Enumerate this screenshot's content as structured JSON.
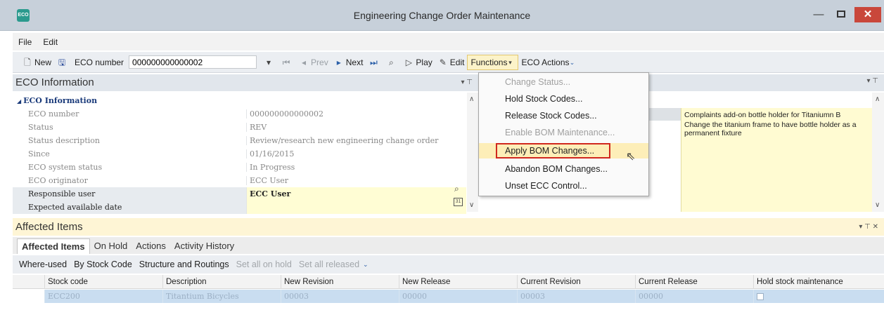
{
  "window": {
    "title": "Engineering Change Order Maintenance",
    "min": "—",
    "close": "✕",
    "app_icon": "ECO"
  },
  "menu": {
    "file": "File",
    "edit": "Edit"
  },
  "toolbar": {
    "new": "New",
    "eco_number_label": "ECO number",
    "eco_number_value": "000000000000002",
    "prev": "Prev",
    "next": "Next",
    "play": "Play",
    "edit": "Edit",
    "functions": "Functions",
    "eco_actions": "ECO Actions"
  },
  "eco_info": {
    "panel_title": "ECO Information",
    "section": "ECO Information",
    "rows": [
      {
        "label": "ECO number",
        "value": "000000000000002"
      },
      {
        "label": "Status",
        "value": "REV"
      },
      {
        "label": "Status description",
        "value": "Review/research new engineering change order"
      },
      {
        "label": "Since",
        "value": "01/16/2015"
      },
      {
        "label": "ECO system status",
        "value": "In Progress"
      },
      {
        "label": "ECO originator",
        "value": "ECC User"
      },
      {
        "label": "Responsible user",
        "value": "ECC User"
      },
      {
        "label": "Expected available date",
        "value": ""
      }
    ]
  },
  "notes": {
    "line1": "Complaints add-on bottle holder for Titaniumn B",
    "line2": "Change the titanium frame to have bottle holder as a permanent fixture"
  },
  "functions_menu": {
    "items": [
      {
        "label": "Change Status...",
        "enabled": false
      },
      {
        "label": "Hold Stock Codes...",
        "enabled": true
      },
      {
        "label": "Release Stock Codes...",
        "enabled": true
      },
      {
        "label": "Enable BOM Maintenance...",
        "enabled": false
      },
      {
        "label": "Apply BOM Changes...",
        "enabled": true,
        "highlighted": true
      },
      {
        "label": "Abandon BOM Changes...",
        "enabled": true
      },
      {
        "label": "Unset ECC Control...",
        "enabled": true
      }
    ]
  },
  "affected": {
    "panel_title": "Affected Items",
    "tabs": [
      "Affected Items",
      "On Hold",
      "Actions",
      "Activity History"
    ],
    "buttons": [
      "Where-used",
      "By Stock Code",
      "Structure and Routings",
      "Set all on hold",
      "Set all released"
    ],
    "columns": [
      "Stock code",
      "Description",
      "New Revision",
      "New Release",
      "Current Revision",
      "Current Release",
      "Hold stock maintenance"
    ],
    "rows": [
      {
        "stock_code": "ECC200",
        "description": "Titantium Bicycles",
        "new_revision": "00003",
        "new_release": "00000",
        "current_revision": "00003",
        "current_release": "00000"
      }
    ]
  },
  "colors": {
    "accent": "#d0281e",
    "highlight": "#fdeeb8",
    "selected_row": "#c9ddf0",
    "yellow_panel": "#fffbd2"
  }
}
